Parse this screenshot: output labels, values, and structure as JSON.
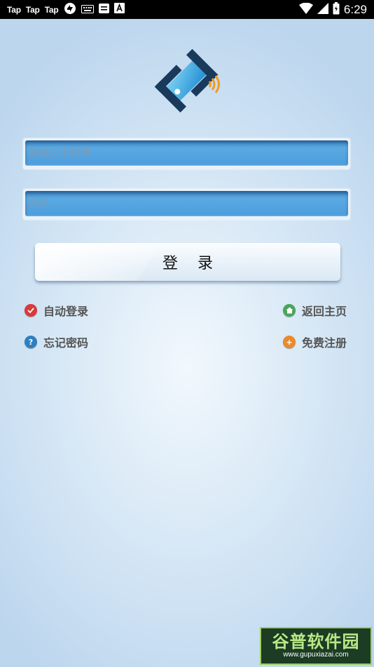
{
  "status_bar": {
    "apps": [
      "Tap",
      "Tap",
      "Tap"
    ],
    "time": "6:29",
    "battery_level": 0.75,
    "icons": [
      "sync-icon",
      "keyboard-icon",
      "message-icon",
      "font-icon",
      "wifi-icon",
      "signal-icon",
      "battery-icon"
    ]
  },
  "login": {
    "phone_placeholder": "请输入手机号",
    "password_placeholder": "密码",
    "login_button": "登录"
  },
  "options": {
    "auto_login": "自动登录",
    "return_home": "返回主页",
    "forgot_password": "忘记密码",
    "free_register": "免费注册"
  },
  "colors": {
    "auto_login_dot": "#d93a3a",
    "return_home_dot": "#4aa55a",
    "forgot_password_dot": "#2f7fc0",
    "register_dot": "#ea8a2c"
  },
  "watermark": {
    "brand": "谷普软件园",
    "url": "www.gupuxiazai.com"
  }
}
